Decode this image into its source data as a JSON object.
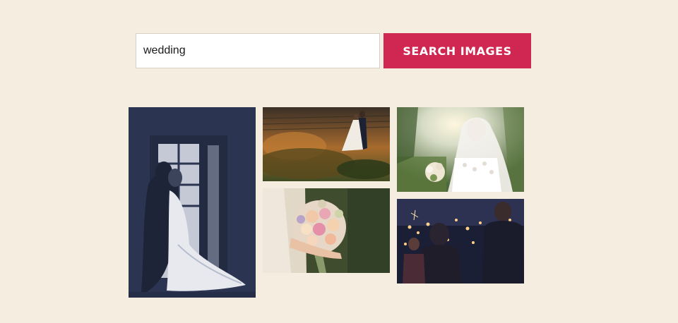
{
  "search": {
    "value": "wedding",
    "button_label": "SEARCH IMAGES"
  },
  "results": [
    {
      "subject": "couple-silhouette-window-photo"
    },
    {
      "subject": "couple-vineyard-photo"
    },
    {
      "subject": "bride-bouquet-photo"
    },
    {
      "subject": "bride-veil-photo"
    },
    {
      "subject": "sparkler-reception-photo"
    }
  ],
  "colors": {
    "background": "#f5eee0",
    "accent": "#d02752"
  }
}
